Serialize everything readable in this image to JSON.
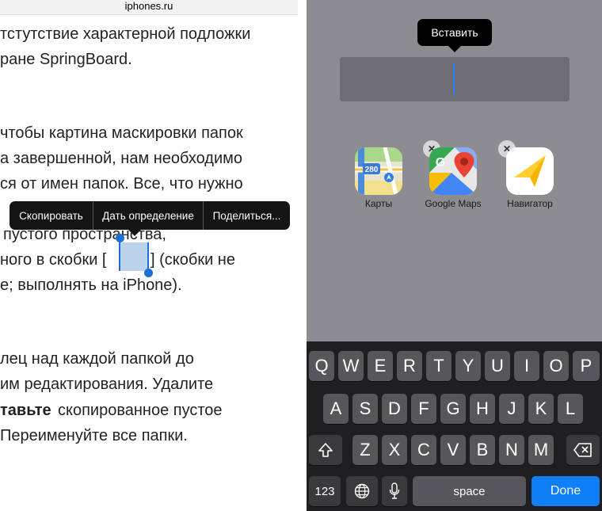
{
  "browser": {
    "url": "iphones.ru"
  },
  "article": {
    "lines": [
      "тстутствие характерной подложки",
      "ране SpringBoard.",
      "чтобы картина маскировки папок",
      "а завершенной, нам необходимо",
      "ся от имен папок. Все, что нужно",
      "пустого пространства,",
      "ного в скобки [",
      "] (скобки не",
      "е; выполнять на iPhone).",
      "лец над каждой папкой до",
      "им редактирования. Удалите",
      "тавьте",
      " скопированное пустое",
      "Переименуйте все папки."
    ]
  },
  "context_menu": {
    "copy": "Скопировать",
    "define": "Дать определение",
    "share": "Поделиться..."
  },
  "paste_tooltip": "Вставить",
  "folder_name_value": "",
  "apps": [
    {
      "label": "Карты",
      "icon": "maps-icon",
      "badge": "280"
    },
    {
      "label": "Google Maps",
      "icon": "google-maps-icon",
      "delete": "✕"
    },
    {
      "label": "Навигатор",
      "icon": "yandex-navigator-icon",
      "delete": "✕"
    }
  ],
  "keyboard": {
    "row1": [
      "Q",
      "W",
      "E",
      "R",
      "T",
      "Y",
      "U",
      "I",
      "O",
      "P"
    ],
    "row2": [
      "A",
      "S",
      "D",
      "F",
      "G",
      "H",
      "J",
      "K",
      "L"
    ],
    "row3": [
      "Z",
      "X",
      "C",
      "V",
      "B",
      "N",
      "M"
    ],
    "numbers": "123",
    "space": "space",
    "done": "Done",
    "shift_icon": "shift-icon",
    "delete_icon": "backspace-icon",
    "globe_icon": "globe-icon",
    "mic_icon": "microphone-icon"
  },
  "colors": {
    "accent": "#0f7ff8",
    "selection": "#bcd3ec",
    "handle": "#1d6fd6",
    "cursor": "#2f7df6"
  }
}
